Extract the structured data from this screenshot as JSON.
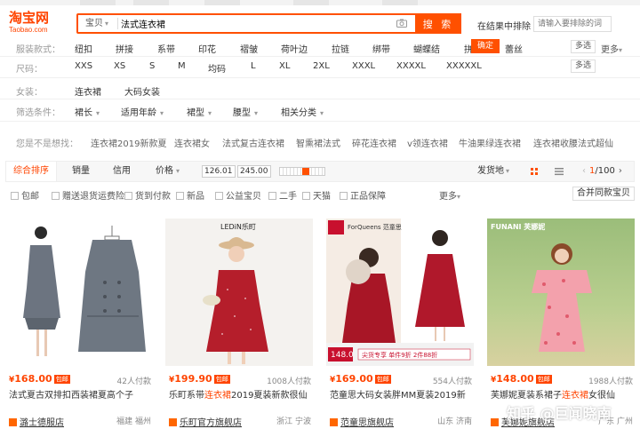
{
  "logo": {
    "main": "淘宝网",
    "sub": "Taobao.com"
  },
  "search": {
    "category": "宝贝",
    "query": "法式连衣裙",
    "button": "搜 索"
  },
  "in_result": {
    "label": "在结果中排除",
    "placeholder": "请输入要排除的词"
  },
  "filters": {
    "style": {
      "label": "服装款式：",
      "items": [
        "纽扣",
        "拼接",
        "系带",
        "印花",
        "褶皱",
        "荷叶边",
        "拉链",
        "绑带",
        "蝴蝶结",
        "拼",
        "蕾丝"
      ],
      "multi": "多选",
      "more": "更多"
    },
    "confirm": "确定",
    "size": {
      "label": "尺码：",
      "items": [
        "XXS",
        "XS",
        "S",
        "M",
        "均码",
        "L",
        "XL",
        "2XL",
        "XXXL",
        "XXXXL",
        "XXXXXL"
      ],
      "multi": "多选"
    },
    "women": {
      "label": "女装：",
      "items": [
        "连衣裙",
        "大码女装"
      ]
    },
    "conditions": {
      "label": "筛选条件：",
      "items": [
        "裙长",
        "适用年龄",
        "裙型",
        "腰型",
        "相关分类"
      ]
    }
  },
  "suggest": {
    "label": "您是不是想找：",
    "items": [
      "连衣裙2019新款夏",
      "连衣裙女",
      "法式复古连衣裙",
      "智熏裙法式",
      "碎花连衣裙",
      "v领连衣裙",
      "牛油果绿连衣裙",
      "连衣裙收腰法式超仙"
    ]
  },
  "sort": {
    "items": [
      "综合排序",
      "销量",
      "信用",
      "价格"
    ],
    "price_min": "126.01",
    "price_max": "245.00",
    "price_sep": "-",
    "ship_from": "发货地",
    "page_current": "1",
    "page_total": "/100"
  },
  "checks": {
    "items": [
      "包邮",
      "赠送退货运费险",
      "货到付款",
      "新品",
      "公益宝贝",
      "二手",
      "天猫",
      "正品保障"
    ],
    "more": "更多",
    "merge": "合并同款宝贝"
  },
  "products": [
    {
      "price": "168.00",
      "ship": "包邮",
      "sold": "42人付款",
      "title_a": "法式夏古双排扣西装裙夏高个子",
      "title_hl": "",
      "title_b": "",
      "shop": "潞士德服店",
      "loc": "福建 福州"
    },
    {
      "price": "199.90",
      "ship": "包邮",
      "sold": "1008人付款",
      "title_a": "乐町系带",
      "title_hl": "连衣裙",
      "title_b": "2019夏装新款很仙",
      "shop": "乐町官方旗舰店",
      "loc": "浙江 宁波"
    },
    {
      "price": "169.00",
      "ship": "包邮",
      "sold": "554人付款",
      "title_a": "范童思大码女装胖MM夏装2019新",
      "title_hl": "",
      "title_b": "",
      "shop": "范童思旗舰店",
      "loc": "山东 济南"
    },
    {
      "price": "148.00",
      "ship": "包邮",
      "sold": "1988人付款",
      "title_a": "芙娜妮夏装系裙子",
      "title_hl": "连衣裙",
      "title_b": "女很仙",
      "shop": "芙娜妮旗舰店",
      "loc": "广东 广州"
    }
  ],
  "img_text": {
    "brand2": "LEDiN乐町",
    "brand3": "ForQueens 范童思",
    "brand4": "FUNANI 芙娜妮",
    "price_tag": "148.0",
    "promo": "尖货专享 单件9折 2件88折"
  },
  "watermark": "知乎 @巨闻晓南"
}
